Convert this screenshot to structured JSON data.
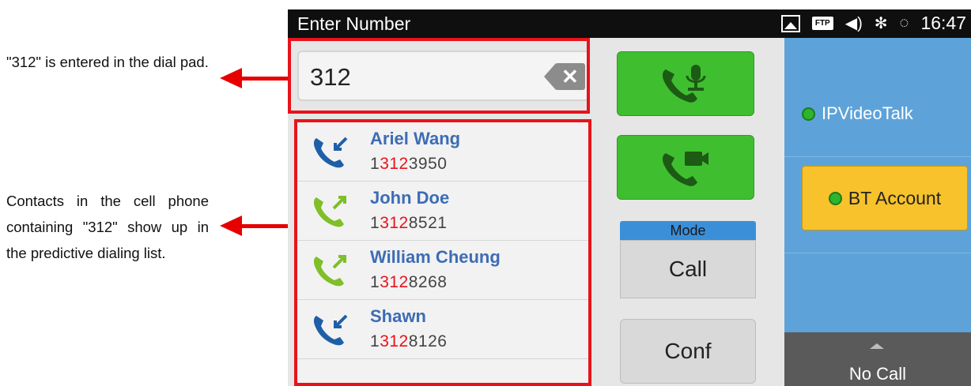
{
  "annotations": {
    "note1": "\"312\" is entered in the dial pad.",
    "note2": "Contacts in the cell phone containing \"312\" show up in the predictive dialing list."
  },
  "statusbar": {
    "title": "Enter Number",
    "ftp_label": "FTP",
    "time": "16:47"
  },
  "dial": {
    "number": "312"
  },
  "contacts": [
    {
      "name": "Ariel Wang",
      "phone_pre": "1",
      "phone_match": "312",
      "phone_post": "3950",
      "direction": "incoming",
      "icon_color": "#1f5fa8"
    },
    {
      "name": "John Doe",
      "phone_pre": "1",
      "phone_match": "312",
      "phone_post": "8521",
      "direction": "outgoing",
      "icon_color": "#7fbf27"
    },
    {
      "name": "William Cheung",
      "phone_pre": "1",
      "phone_match": "312",
      "phone_post": "8268",
      "direction": "outgoing",
      "icon_color": "#7fbf27"
    },
    {
      "name": "Shawn",
      "phone_pre": "1",
      "phone_match": "312",
      "phone_post": "8126",
      "direction": "incoming",
      "icon_color": "#1f5fa8"
    }
  ],
  "buttons": {
    "mode_label": "Mode",
    "mode_value": "Call",
    "conf": "Conf"
  },
  "accounts": {
    "ipvideotalk": "IPVideoTalk",
    "bt": "BT Account"
  },
  "call_status": "No Call",
  "colors": {
    "highlight_box": "#e8131b",
    "green_button": "#3fbf2f",
    "account_pane": "#5da3d9",
    "bt_account": "#f7c22b"
  }
}
